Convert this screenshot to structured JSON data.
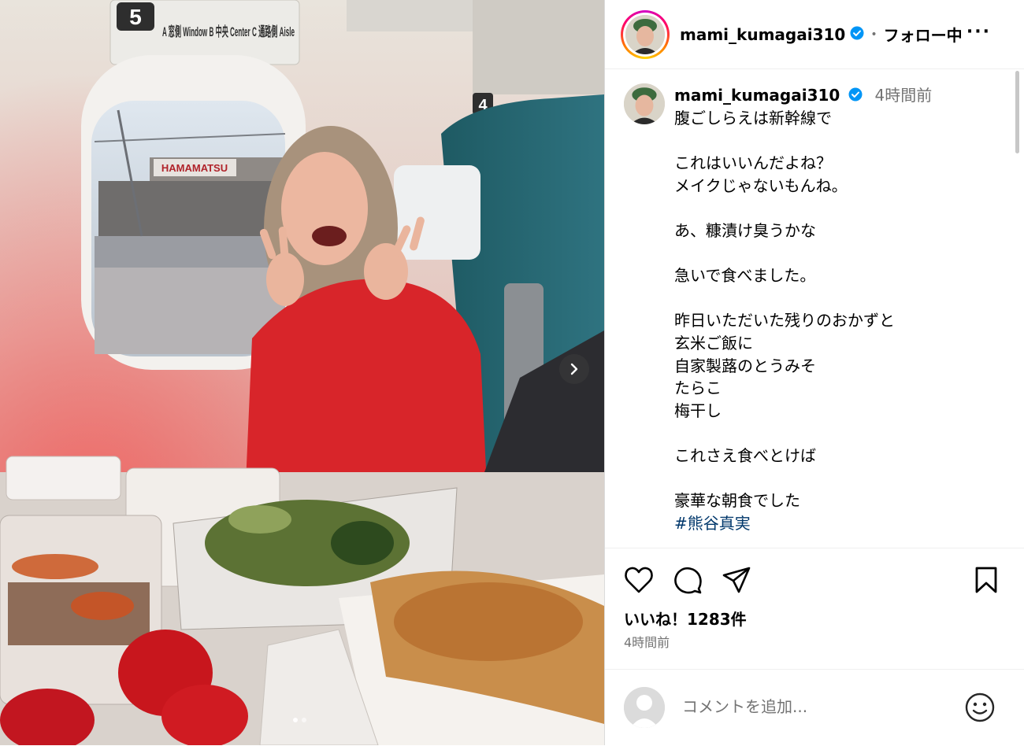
{
  "media": {
    "seat_sign_5": "5",
    "seat_sign_letters": "A 窓側 Window   B 中央 Center   C 通路側 Aisle",
    "seat_sign_4": "4",
    "station_sign": "HAMAMATSU",
    "icons": {
      "next": "chevron-right-icon"
    },
    "carousel_dots": 2,
    "carousel_active": 0
  },
  "header": {
    "username": "mami_kumagai310",
    "separator": "•",
    "follow_label": "フォロー中",
    "more_label": "···"
  },
  "caption": {
    "username": "mami_kumagai310",
    "time": "4時間前",
    "text": "腹ごしらえは新幹線で\n\nこれはいいんだよね？\nメイクじゃないもんね。\n\nあ、糠漬け臭うかな\n\n急いで食べました。\n\n昨日いただいた残りのおかずと\n玄米ご飯に\n自家製蕗のとうみそ\nたらこ\n梅干し\n\nこれさえ食べとけば\n\n豪華な朝食でした",
    "hashtag": "#熊谷真実"
  },
  "actions": {
    "icons": [
      "heart-icon",
      "comment-icon",
      "share-icon",
      "bookmark-icon"
    ],
    "likes": "いいね！1283件",
    "time": "4時間前"
  },
  "comment": {
    "placeholder": "コメントを追加...",
    "icon": "emoji-icon"
  },
  "colors": {
    "verified": "#0095f6",
    "text_secondary": "#737373",
    "hashtag": "#00376b"
  }
}
